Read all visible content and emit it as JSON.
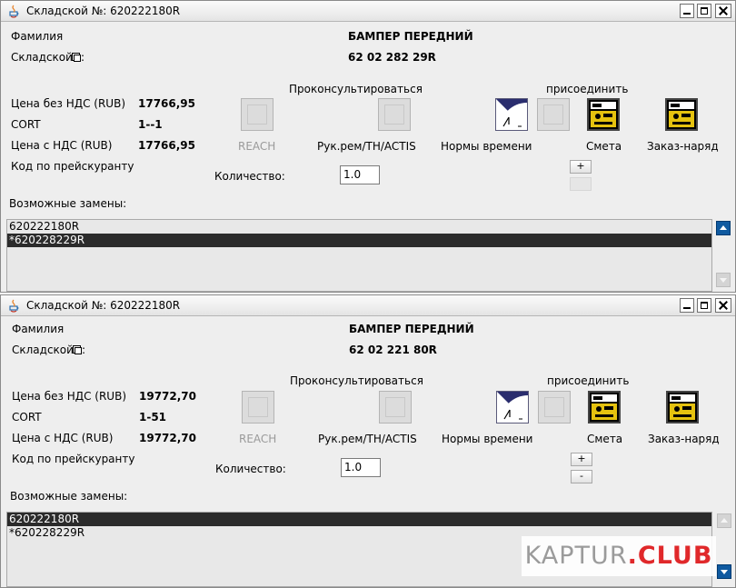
{
  "colors": {
    "selection": "#2b2b2b",
    "scroll_active": "#0f5aa0",
    "watermark_accent": "#e0282a"
  },
  "windows": [
    {
      "title": "Складской №: 620222180R",
      "labels": {
        "surname": "Фамилия",
        "warehouse": "Складской",
        "warehouse_icon": "copy-icon",
        "price_no_vat": "Цена без НДС (RUB)",
        "cort": "CORT",
        "price_vat": "Цена с НДС (RUB)",
        "price_list_code": "Код по прейскуранту",
        "consult": "Проконсультироваться",
        "attach": "присоединить",
        "quantity": "Количество:",
        "replacements": "Возможные замены:"
      },
      "values": {
        "part_name": "БАМПЕР ПЕРЕДНИЙ",
        "part_number": "62 02 282 29R",
        "price_no_vat": "17766,95",
        "cort": "1--1",
        "price_vat": "17766,95",
        "quantity": "1.0"
      },
      "buttons": {
        "reach": "REACH",
        "repair_manual": "Рук.рем/TH/ACTIS",
        "time_norms": "Нормы времени",
        "estimate": "Смета",
        "work_order": "Заказ-наряд",
        "plus": "+",
        "minus": ""
      },
      "replacements": [
        "620222180R",
        "*620228229R"
      ],
      "selected_replacement": 1
    },
    {
      "title": "Складской №: 620222180R",
      "labels": {
        "surname": "Фамилия",
        "warehouse": "Складской",
        "warehouse_icon": "copy-icon",
        "price_no_vat": "Цена без НДС (RUB)",
        "cort": "CORT",
        "price_vat": "Цена с НДС (RUB)",
        "price_list_code": "Код по прейскуранту",
        "consult": "Проконсультироваться",
        "attach": "присоединить",
        "quantity": "Количество:",
        "replacements": "Возможные замены:"
      },
      "values": {
        "part_name": "БАМПЕР ПЕРЕДНИЙ",
        "part_number": "62 02 221 80R",
        "price_no_vat": "19772,70",
        "cort": "1-51",
        "price_vat": "19772,70",
        "quantity": "1.0"
      },
      "buttons": {
        "reach": "REACH",
        "repair_manual": "Рук.рем/TH/ACTIS",
        "time_norms": "Нормы времени",
        "estimate": "Смета",
        "work_order": "Заказ-наряд",
        "plus": "+",
        "minus": "-"
      },
      "replacements": [
        "620222180R",
        "*620228229R"
      ],
      "selected_replacement": 0
    }
  ],
  "watermark": {
    "text": "KAPTUR",
    "accent": ".CLUB"
  }
}
